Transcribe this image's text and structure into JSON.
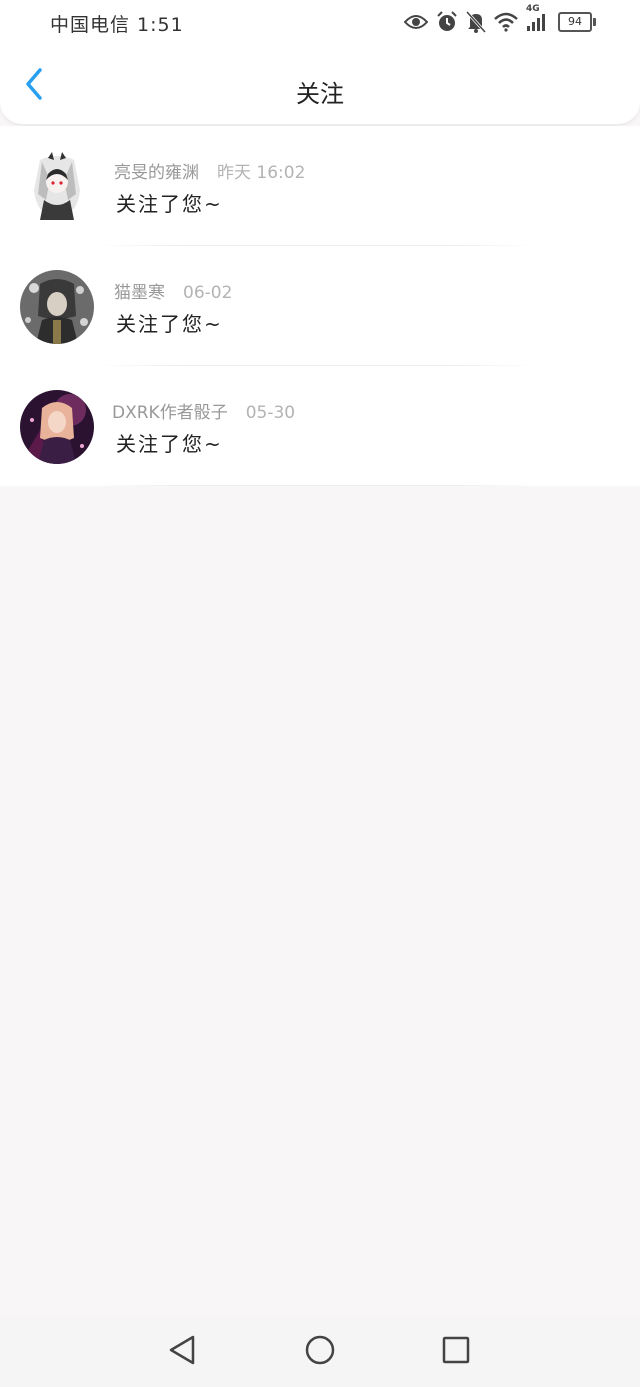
{
  "status_bar": {
    "carrier_time": "中国电信 1:51",
    "network_label": "4G",
    "battery_level": "94",
    "icons": [
      "eye-icon",
      "alarm-icon",
      "bell-off-icon",
      "wifi-icon",
      "signal-icon",
      "battery-icon"
    ]
  },
  "header": {
    "title": "关注",
    "back_icon": "chevron-left-icon"
  },
  "colors": {
    "accent": "#2a9ff0",
    "background": "#f8f6f7",
    "card": "#ffffff",
    "name_text": "#999999",
    "body_text": "#222222"
  },
  "notifications": [
    {
      "name": "亮旻的雍渊",
      "time": "昨天 16:02",
      "text": "关注了您~"
    },
    {
      "name": "猫墨寒",
      "time": "06-02",
      "text": "关注了您~"
    },
    {
      "name": "DXRK作者骰子",
      "time": "05-30",
      "text": "关注了您~"
    }
  ],
  "system_nav": {
    "buttons": [
      "back-triangle-icon",
      "home-circle-icon",
      "recents-square-icon"
    ]
  }
}
